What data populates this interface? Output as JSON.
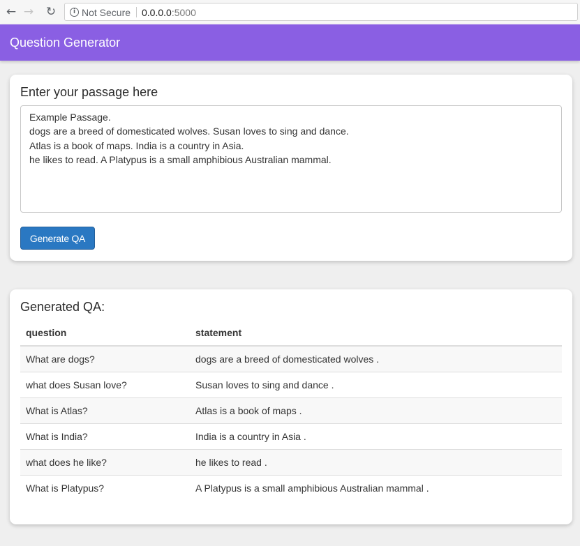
{
  "browser": {
    "security_label": "Not Secure",
    "url_host": "0.0.0.0",
    "url_port": ":5000"
  },
  "navbar": {
    "brand": "Question Generator"
  },
  "input_card": {
    "title": "Enter your passage here",
    "passage": "Example Passage.\ndogs are a breed of domesticated wolves. Susan loves to sing and dance.\nAtlas is a book of maps. India is a country in Asia.\nhe likes to read. A Platypus is a small amphibious Australian mammal.",
    "button_label": "Generate QA"
  },
  "output_card": {
    "title": "Generated QA:",
    "columns": [
      "question",
      "statement"
    ],
    "rows": [
      [
        "What are dogs?",
        "dogs are a breed of domesticated wolves ."
      ],
      [
        "what does Susan love?",
        "Susan loves to sing and dance ."
      ],
      [
        "What is Atlas?",
        "Atlas is a book of maps ."
      ],
      [
        "What is India?",
        "India is a country in Asia ."
      ],
      [
        "what does he like?",
        "he likes to read ."
      ],
      [
        "What is Platypus?",
        "A Platypus is a small amphibious Australian mammal ."
      ]
    ]
  }
}
